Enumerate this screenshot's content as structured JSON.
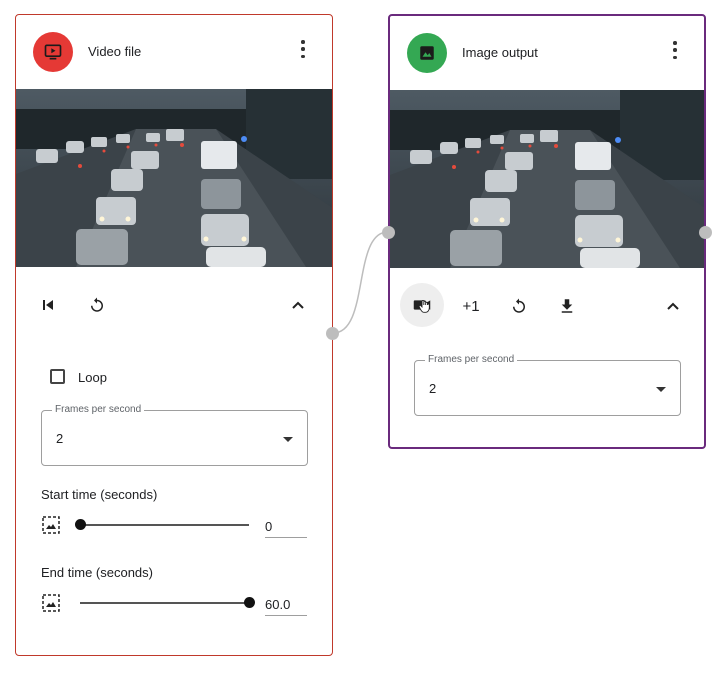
{
  "connection_color": "#bdbdbd",
  "video_node": {
    "title": "Video file",
    "accent": "#c0392b",
    "avatar_color": "#e53935",
    "avatar_icon": "video-play-icon",
    "toolbar_icons": [
      "skip-to-start-icon",
      "restart-icon",
      "chevron-up-icon"
    ],
    "loop_label": "Loop",
    "loop_checked": false,
    "fps": {
      "legend": "Frames per second",
      "value": "2"
    },
    "start_time": {
      "label": "Start time (seconds)",
      "value": "0",
      "slider_fraction": 0
    },
    "end_time": {
      "label": "End time (seconds)",
      "value": "60.0",
      "slider_fraction": 1
    }
  },
  "image_node": {
    "title": "Image output",
    "accent": "#6a2a7d",
    "avatar_color": "#34a853",
    "avatar_icon": "image-icon",
    "toolbar": {
      "increment_label": "+1",
      "icons": [
        "capture-icon",
        "restart-icon",
        "download-icon",
        "chevron-up-icon"
      ]
    },
    "fps": {
      "legend": "Frames per second",
      "value": "2"
    }
  }
}
